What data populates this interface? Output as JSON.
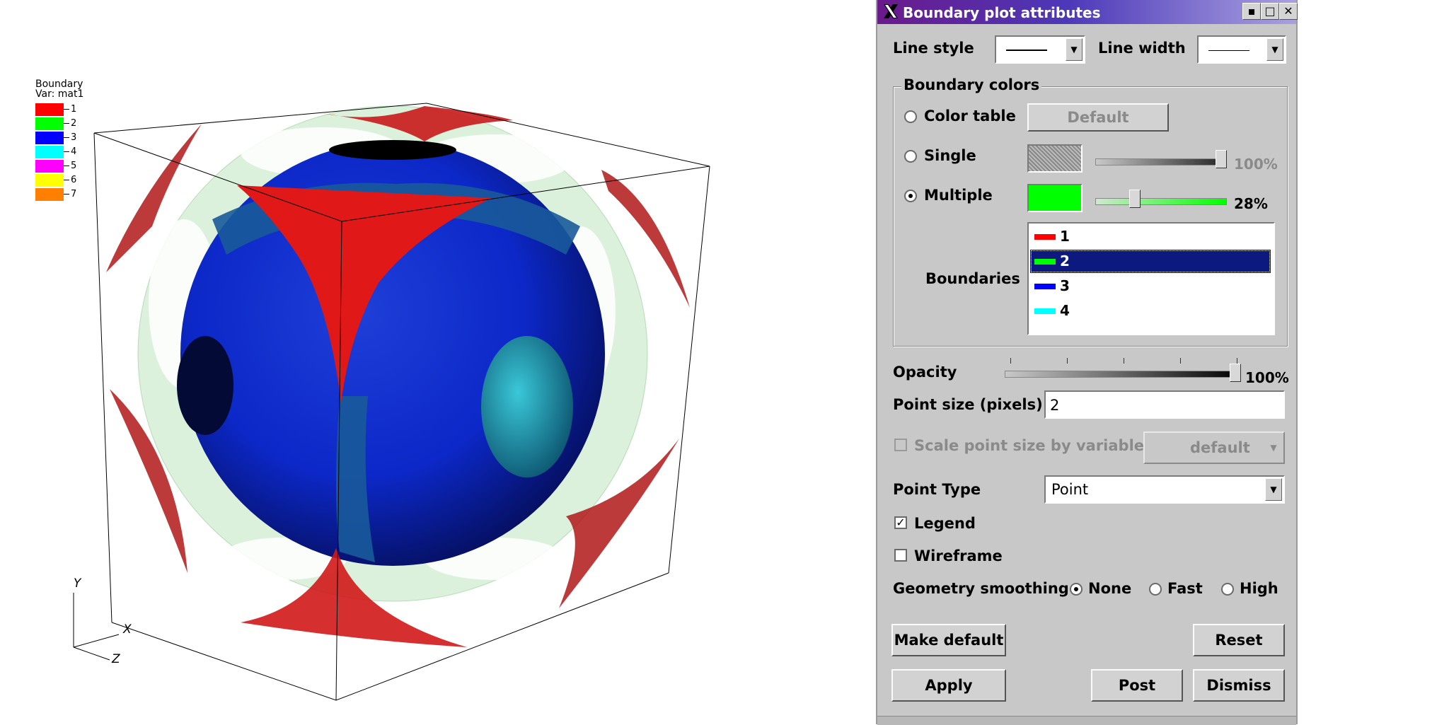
{
  "viz": {
    "legend": {
      "title_line1": "Boundary",
      "title_line2": "Var: mat1",
      "entries": [
        {
          "label": "1",
          "color": "#ff0000"
        },
        {
          "label": "2",
          "color": "#00ff00"
        },
        {
          "label": "3",
          "color": "#0000ff"
        },
        {
          "label": "4",
          "color": "#00ffff"
        },
        {
          "label": "5",
          "color": "#ff00ff"
        },
        {
          "label": "6",
          "color": "#ffff00"
        },
        {
          "label": "7",
          "color": "#ff8000"
        }
      ]
    },
    "axes": {
      "y": "Y",
      "x": "X",
      "z": "Z"
    }
  },
  "dialog": {
    "title": "Boundary plot attributes",
    "window_buttons": {
      "minimize": "▪",
      "maximize": "□",
      "close": "✕"
    },
    "line_style_label": "Line style",
    "line_width_label": "Line width",
    "boundary_colors_group": "Boundary colors",
    "color_table_label": "Color table",
    "color_table_button": "Default",
    "single_label": "Single",
    "single_opacity": "100%",
    "multiple_label": "Multiple",
    "multiple_color": "#00ff00",
    "multiple_opacity": "28%",
    "boundaries_label": "Boundaries",
    "boundaries": [
      {
        "label": "1",
        "color": "#ff0000"
      },
      {
        "label": "2",
        "color": "#00ff00"
      },
      {
        "label": "3",
        "color": "#0000ff"
      },
      {
        "label": "4",
        "color": "#00ffff"
      }
    ],
    "selected_boundary": "2",
    "opacity_label": "Opacity",
    "opacity_value": "100%",
    "point_size_label": "Point size (pixels)",
    "point_size_value": "2",
    "scale_point_label": "Scale point size by variable",
    "scale_point_combo": "default",
    "point_type_label": "Point Type",
    "point_type_value": "Point",
    "legend_label": "Legend",
    "legend_checked": true,
    "wireframe_label": "Wireframe",
    "wireframe_checked": false,
    "smoothing_label": "Geometry smoothing",
    "smoothing_options": [
      "None",
      "Fast",
      "High"
    ],
    "smoothing_selected": "None",
    "make_default_button": "Make default",
    "reset_button": "Reset",
    "apply_button": "Apply",
    "post_button": "Post",
    "dismiss_button": "Dismiss"
  }
}
